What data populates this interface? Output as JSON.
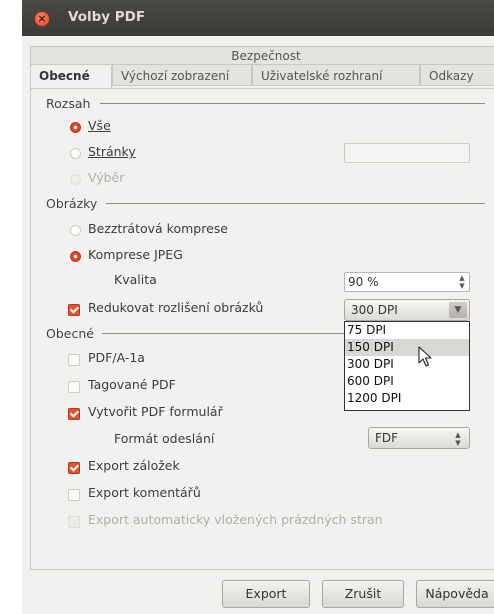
{
  "window": {
    "title": "Volby PDF",
    "close_glyph": "×"
  },
  "tabs": {
    "top_row": "Bezpečnost",
    "items": [
      "Obecné",
      "Výchozí zobrazení",
      "Uživatelské rozhraní",
      "Odkazy"
    ],
    "active": "Obecné"
  },
  "range": {
    "heading": "Rozsah",
    "all": "Vše",
    "pages": "Stránky",
    "pages_value": "",
    "selection": "Výběr"
  },
  "images": {
    "heading": "Obrázky",
    "lossless": "Bezztrátová komprese",
    "jpeg": "Komprese JPEG",
    "quality_label": "Kvalita",
    "quality_value": "90 %",
    "reduce_label": "Redukovat rozlišení obrázků",
    "reduce_value": "300 DPI",
    "dpi_options": [
      "75 DPI",
      "150 DPI",
      "300 DPI",
      "600 DPI",
      "1200 DPI"
    ],
    "highlighted_option": "150 DPI"
  },
  "general": {
    "heading": "Obecné",
    "pdfa": "PDF/A-1a",
    "tagged": "Tagované PDF",
    "create_form": "Vytvořit PDF formulář",
    "submit_format_label": "Formát odeslání",
    "submit_format_value": "FDF",
    "export_bookmarks": "Export záložek",
    "export_comments": "Export komentářů",
    "export_blank": "Export automaticky vložených prázdných stran"
  },
  "buttons": {
    "export": "Export",
    "cancel": "Zrušit",
    "help": "Nápověda"
  },
  "colors": {
    "accent": "#e4522f",
    "titlebar": "#3b3a36",
    "window_bg": "#f2f1f0"
  }
}
